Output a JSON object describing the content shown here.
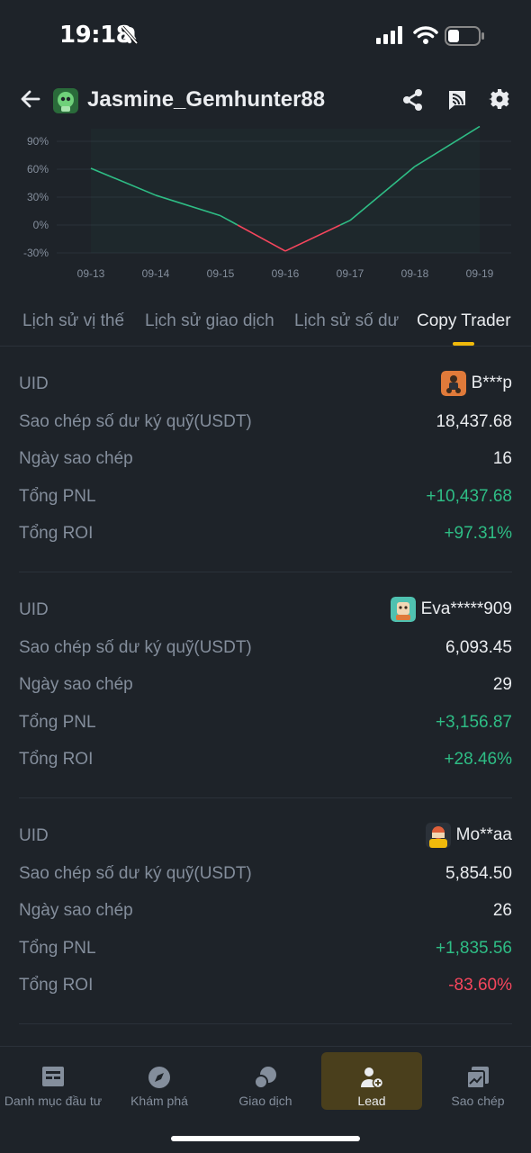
{
  "status": {
    "time": "19:18"
  },
  "header": {
    "title": "Jasmine_Gemhunter88"
  },
  "chart_data": {
    "type": "line",
    "x": [
      "09-13",
      "09-14",
      "09-15",
      "09-16",
      "09-17",
      "09-18",
      "09-19"
    ],
    "y_ticks": [
      "90%",
      "60%",
      "30%",
      "0%",
      "-30%"
    ],
    "y_tick_values": [
      90,
      60,
      30,
      0,
      -30
    ],
    "series": [
      {
        "values": [
          61,
          32,
          10,
          -28,
          5,
          63,
          106
        ]
      }
    ],
    "ylim": [
      -30,
      90
    ],
    "colors": {
      "positive": "#2ebd85",
      "negative": "#f6465d"
    }
  },
  "tabs": [
    "Lịch sử vị thế",
    "Lịch sử giao dịch",
    "Lịch sử số dư",
    "Copy Trader"
  ],
  "labels": {
    "uid": "UID",
    "margin": "Sao chép số dư ký quỹ(USDT)",
    "days": "Ngày sao chép",
    "pnl": "Tổng PNL",
    "roi": "Tổng ROI"
  },
  "copiers": [
    {
      "uid": "B***p",
      "margin": "18,437.68",
      "days": "16",
      "pnl": "+10,437.68",
      "roi": "+97.31%"
    },
    {
      "uid": "Eva*****909",
      "margin": "6,093.45",
      "days": "29",
      "pnl": "+3,156.87",
      "roi": "+28.46%"
    },
    {
      "uid": "Mo**aa",
      "margin": "5,854.50",
      "days": "26",
      "pnl": "+1,835.56",
      "roi": "-83.60%"
    }
  ],
  "nav": [
    {
      "label": "Danh mục đầu tư",
      "icon": "portfolio-icon"
    },
    {
      "label": "Khám phá",
      "icon": "compass-icon"
    },
    {
      "label": "Giao dịch",
      "icon": "trade-icon"
    },
    {
      "label": "Lead",
      "icon": "lead-icon"
    },
    {
      "label": "Sao chép",
      "icon": "copy-chart-icon"
    }
  ],
  "colors": {
    "background": "#1e2329",
    "accent": "#f0b90b",
    "green": "#2ebd85",
    "red": "#f6465d"
  }
}
